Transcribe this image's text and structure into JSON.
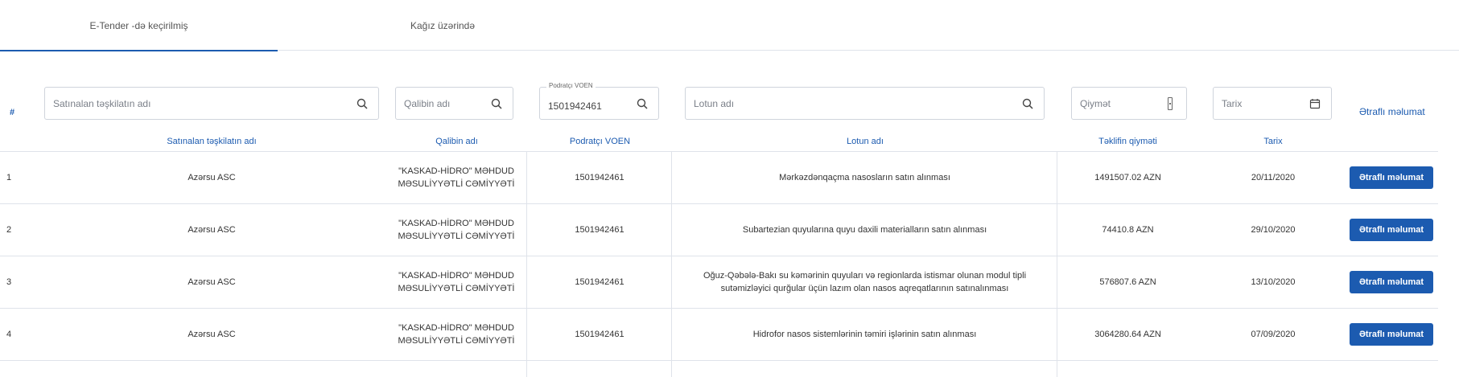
{
  "tabs": [
    {
      "label": "E-Tender -də keçirilmiş",
      "active": true
    },
    {
      "label": "Kağız üzərində",
      "active": false
    }
  ],
  "filters": {
    "hash": "#",
    "org_placeholder": "Satınalan təşkilatın adı",
    "template_placeholder": "Qalibin adı",
    "voen_label": "Podratçı VOEN",
    "voen_value": "1501942461",
    "lot_placeholder": "Lotun adı",
    "price_placeholder": "Qiymət",
    "date_placeholder": "Tarix",
    "details_label": "Ətraflı məlumat"
  },
  "columns": {
    "org": "Satınalan təşkilatın adı",
    "winner": "Qalibin adı",
    "voen": "Podratçı VOEN",
    "lot": "Lotun adı",
    "price": "Təklifin qiyməti",
    "date": "Tarix"
  },
  "rows": [
    {
      "num": "1",
      "org": "Azərsu ASC",
      "winner": "\"KASKAD-HİDRO\" MƏHDUD MƏSULİYYƏTLİ CƏMİYYƏTİ",
      "voen": "1501942461",
      "lot": "Mərkəzdənqaçma nasosların satın alınması",
      "price": "1491507.02 AZN",
      "date": "20/11/2020",
      "button": "Ətraflı məlumat"
    },
    {
      "num": "2",
      "org": "Azərsu ASC",
      "winner": "\"KASKAD-HİDRO\" MƏHDUD MƏSULİYYƏTLİ CƏMİYYƏTİ",
      "voen": "1501942461",
      "lot": "Subartezian quyularına quyu daxili materialların satın alınması",
      "price": "74410.8 AZN",
      "date": "29/10/2020",
      "button": "Ətraflı məlumat"
    },
    {
      "num": "3",
      "org": "Azərsu ASC",
      "winner": "\"KASKAD-HİDRO\" MƏHDUD MƏSULİYYƏTLİ CƏMİYYƏTİ",
      "voen": "1501942461",
      "lot": "Oğuz-Qəbələ-Bakı su kəmərinin quyuları və regionlarda istismar olunan modul tipli sutəmizləyici qurğular üçün lazım olan nasos aqreqatlarının satınalınması",
      "price": "576807.6 AZN",
      "date": "13/10/2020",
      "button": "Ətraflı məlumat"
    },
    {
      "num": "4",
      "org": "Azərsu ASC",
      "winner": "\"KASKAD-HİDRO\" MƏHDUD MƏSULİYYƏTLİ CƏMİYYƏTİ",
      "voen": "1501942461",
      "lot": "Hidrofor nasos sistemlərinin təmiri işlərinin satın alınması",
      "price": "3064280.64 AZN",
      "date": "07/09/2020",
      "button": "Ətraflı məlumat"
    }
  ],
  "colors": {
    "accent": "#1c5bb0",
    "border": "#dfe3ea"
  }
}
